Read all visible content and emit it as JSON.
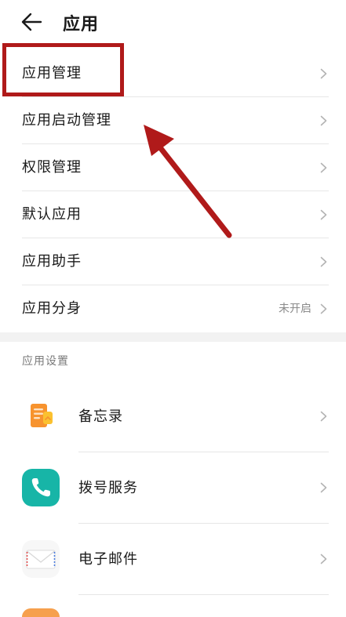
{
  "header": {
    "title": "应用",
    "back_icon": "arrow-left-icon"
  },
  "menu": {
    "items": [
      {
        "label": "应用管理",
        "value": ""
      },
      {
        "label": "应用启动管理",
        "value": ""
      },
      {
        "label": "权限管理",
        "value": ""
      },
      {
        "label": "默认应用",
        "value": ""
      },
      {
        "label": "应用助手",
        "value": ""
      },
      {
        "label": "应用分身",
        "value": "未开启"
      }
    ]
  },
  "app_settings": {
    "section_title": "应用设置",
    "items": [
      {
        "label": "备忘录",
        "icon": "notepad-icon"
      },
      {
        "label": "拨号服务",
        "icon": "phone-icon"
      },
      {
        "label": "电子邮件",
        "icon": "envelope-icon"
      }
    ]
  },
  "colors": {
    "annotation_red": "#b01a1a",
    "notepad_orange": "#f7932e",
    "phone_teal": "#17b5a7",
    "divider": "#e6e6e6",
    "secondary_text": "#8a8a8a"
  }
}
